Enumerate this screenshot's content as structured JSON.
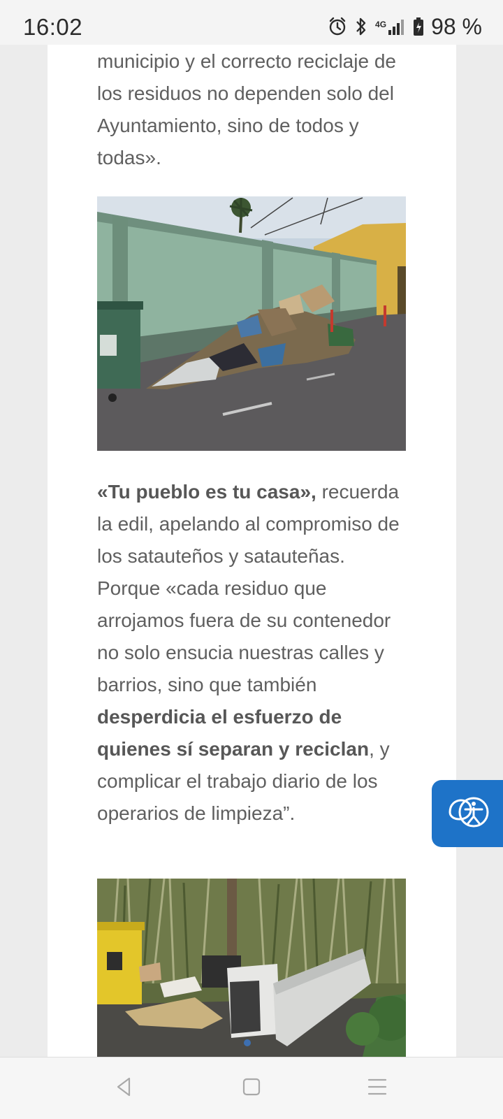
{
  "status_bar": {
    "time": "16:02",
    "network": "4G",
    "battery": "98 %",
    "icons": [
      "alarm-icon",
      "bluetooth-icon",
      "signal-icon",
      "battery-icon"
    ]
  },
  "article": {
    "paragraph1": "municipio y el correcto reciclaje de los residuos no dependen solo del Ayuntamiento, sino de todos y todas».",
    "paragraph2": {
      "bold_quote": "«Tu pueblo es tu casa»,",
      "text_a": " recuerda la edil, apelando al compromiso de los satauteños y satauteñas. Porque «cada residuo que arrojamos fuera de su contenedor no solo ensucia nuestras calles y barrios, sino que también ",
      "bold_middle": "desperdicia el esfuerzo de quienes sí separan y reciclan",
      "text_b": ", y complicar el trabajo diario de los operarios de limpieza”."
    },
    "images": [
      "photo-waste-by-wall",
      "photo-appliances-dumped"
    ]
  },
  "accessibility": {
    "icon": "accessibility-icon",
    "color": "#1e73c8"
  },
  "nav_bar": {
    "icons": [
      "back-icon",
      "home-icon",
      "menu-icon"
    ]
  }
}
